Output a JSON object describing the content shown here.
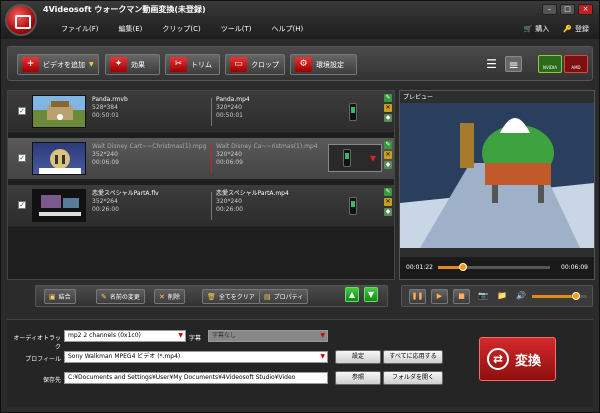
{
  "app": {
    "title": "4Videosoft ウォークマン動画変換(未登録)",
    "window_buttons": [
      "–",
      "□",
      "×"
    ]
  },
  "menu": [
    {
      "label": "ファイル(F)"
    },
    {
      "label": "編集(E)"
    },
    {
      "label": "クリップ(C)"
    },
    {
      "label": "ツール(T)"
    },
    {
      "label": "ヘルプ(H)"
    }
  ],
  "topright": {
    "buy": "購入",
    "register": "登録"
  },
  "toolbar": {
    "add_video": "ビデオを追加",
    "effect": "効果",
    "trim": "トリム",
    "crop": "クロップ",
    "preferences": "環境設定",
    "nvidia": "NVIDIA",
    "amd": "AMD"
  },
  "files": [
    {
      "name": "Panda.rmvb",
      "res": "528*384",
      "dur": "00:50:01",
      "out_name": "Panda.mp4",
      "out_res": "320*240",
      "out_dur": "00:50:01",
      "selected": false
    },
    {
      "name": "Walt Disney Cart~~Christmas(1).mpg",
      "res": "352*240",
      "dur": "00:06:09",
      "out_name": "Walt Disney Ca~~ristmas(1).mp4",
      "out_res": "320*240",
      "out_dur": "00:06:09",
      "selected": true
    },
    {
      "name": "恋愛スペシャルPartA.flv",
      "res": "352*264",
      "dur": "00:26:00",
      "out_name": "恋愛スペシャルPartA.mp4",
      "out_res": "320*240",
      "out_dur": "00:26:00",
      "selected": false
    }
  ],
  "preview": {
    "label": "プレビュー",
    "time_current": "00:01:22",
    "time_total": "00:06:09",
    "progress": 0.22,
    "volume": 0.8
  },
  "actions": {
    "merge": "結合",
    "rename": "名前の変更",
    "delete": "削除",
    "clear_all": "全てをクリア",
    "properties": "プロパティ"
  },
  "settings": {
    "audio_track_label": "オーディオトラック",
    "audio_track_value": "mp2 2 channels (0x1c0)",
    "subtitle_label": "字幕",
    "subtitle_value": "字幕なし",
    "profile_label": "プロフィール",
    "profile_value": "Sony Walkman MPEG4 ビデオ (*.mp4)",
    "settings_button": "設定",
    "apply_all_button": "すべてに応用する",
    "save_label": "保存先",
    "save_path": "C:¥Documents and Settings¥User¥My Documents¥4Videosoft Studio¥Video",
    "browse_button": "参照",
    "open_folder_button": "フォルダを開く"
  },
  "convert_button": "変換"
}
